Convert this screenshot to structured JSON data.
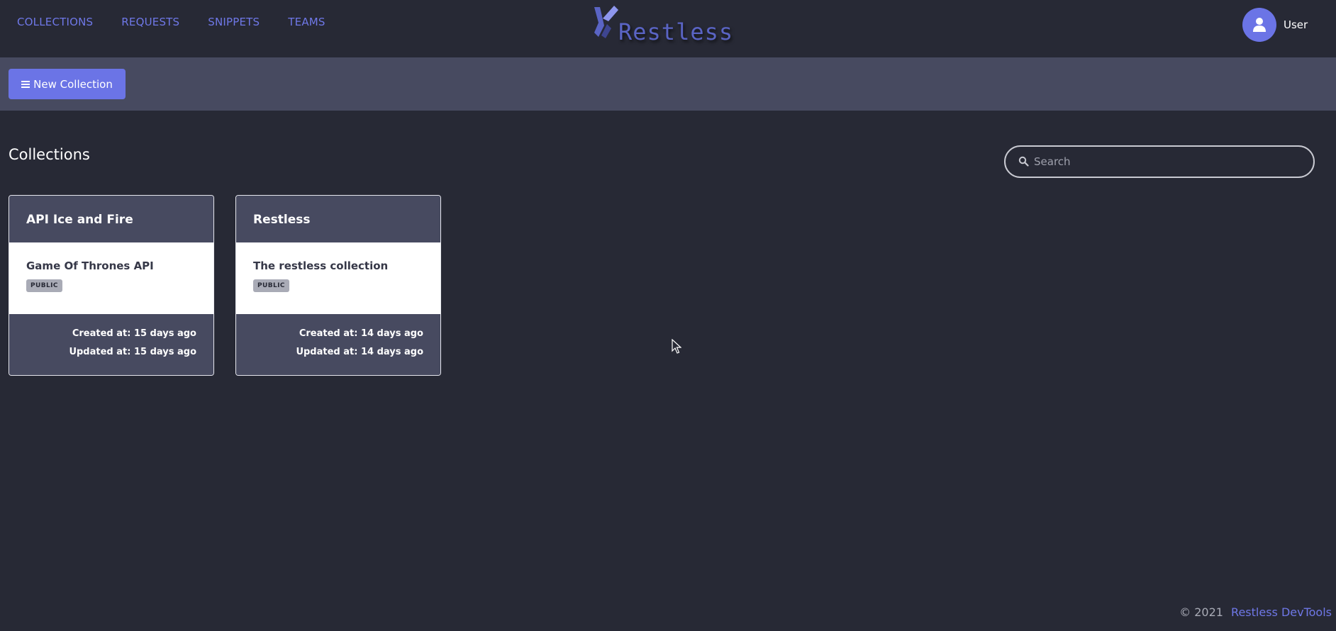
{
  "nav": {
    "links": [
      "COLLECTIONS",
      "REQUESTS",
      "SNIPPETS",
      "TEAMS"
    ],
    "logo_text": "Restless",
    "user_name": "User"
  },
  "toolbar": {
    "new_collection_label": "New Collection"
  },
  "main": {
    "title": "Collections",
    "search_placeholder": "Search",
    "search_value": ""
  },
  "cards": [
    {
      "name": "API Ice and Fire",
      "description": "Game Of Thrones API",
      "visibility": "PUBLIC",
      "created": "Created at: 15 days ago",
      "updated": "Updated at: 15 days ago"
    },
    {
      "name": "Restless",
      "description": "The restless collection",
      "visibility": "PUBLIC",
      "created": "Created at: 14 days ago",
      "updated": "Updated at: 14 days ago"
    }
  ],
  "footer": {
    "copyright": "© 2021",
    "link": "Restless DevTools"
  },
  "colors": {
    "background": "#272935",
    "panel": "#474a60",
    "accent": "#6b74e6",
    "link": "#6f78e8"
  },
  "icons": [
    "menu-icon",
    "search-icon",
    "user-icon",
    "logo-icon",
    "cursor-icon"
  ]
}
